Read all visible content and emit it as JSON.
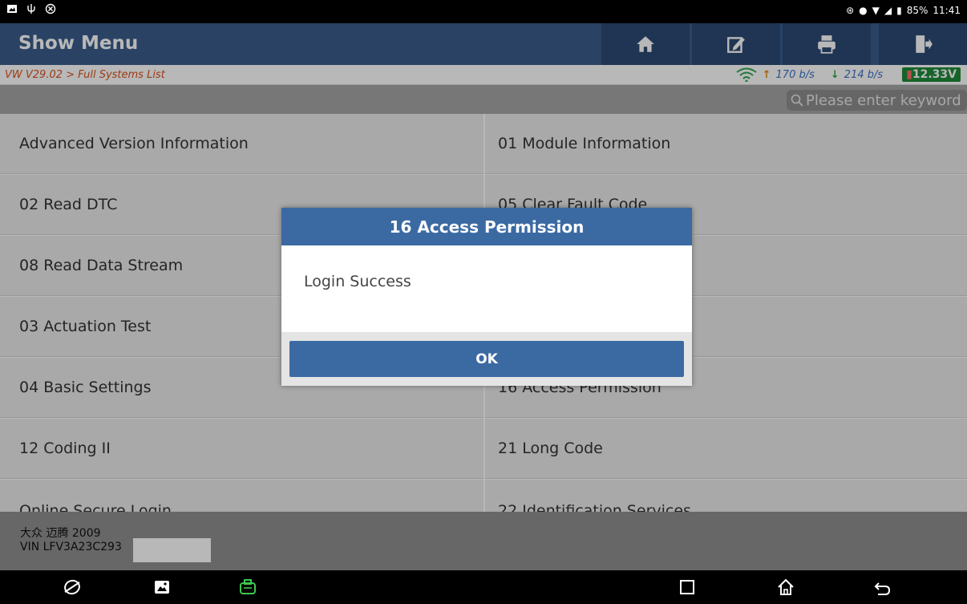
{
  "status_bar": {
    "battery": "85%",
    "time": "11:41"
  },
  "header": {
    "title": "Show Menu",
    "buttons": [
      "home",
      "edit",
      "print",
      "exit"
    ]
  },
  "breadcrumb": {
    "path": "VW V29.02 > Full Systems List"
  },
  "network": {
    "upload": "170 b/s",
    "download": "214 b/s",
    "voltage": "12.33V"
  },
  "search": {
    "placeholder": "Please enter keyword"
  },
  "menu": {
    "left": [
      "Advanced Version Information",
      "02 Read DTC",
      "08 Read Data Stream",
      "03 Actuation Test",
      "04 Basic Settings",
      "12 Coding II",
      "Online Secure Login"
    ],
    "right": [
      "01 Module Information",
      "05 Clear Fault Code",
      "",
      "",
      "16 Access Permission",
      "21 Long Code",
      "22 Identification Services"
    ]
  },
  "footer": {
    "vehicle": "大众 迈腾 2009",
    "vin": "VIN LFV3A23C293"
  },
  "dialog": {
    "title": "16 Access Permission",
    "message": "Login Success",
    "ok_label": "OK"
  },
  "colors": {
    "header": "#3b5e8c",
    "dialog_accent": "#3b6aa3",
    "breadcrumb": "#d9531e",
    "voltage_bg": "#1f8b3a"
  }
}
